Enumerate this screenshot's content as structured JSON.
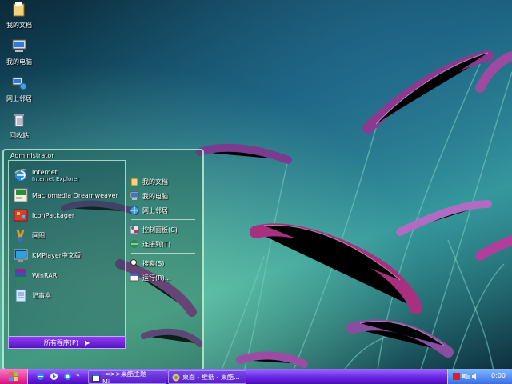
{
  "desktop": {
    "icons": [
      {
        "label": "我的文档",
        "icon": "folder-icon"
      },
      {
        "label": "我的电脑",
        "icon": "computer-icon"
      },
      {
        "label": "网上邻居",
        "icon": "network-icon"
      },
      {
        "label": "回收站",
        "icon": "recycle-bin-icon"
      }
    ]
  },
  "start_menu": {
    "user": "Administrator",
    "pinned": [
      {
        "title": "Internet",
        "subtitle": "Internet Explorer",
        "icon": "ie-icon"
      },
      {
        "title": "Macromedia Dreamweaver",
        "icon": "dreamweaver-icon"
      },
      {
        "title": "IconPackager",
        "icon": "iconpackager-icon"
      },
      {
        "title": "画图",
        "icon": "paint-icon"
      },
      {
        "title": "KMPlayer中文版",
        "icon": "kmplayer-icon"
      },
      {
        "title": "WinRAR",
        "icon": "winrar-icon"
      },
      {
        "title": "记事本",
        "icon": "notepad-icon"
      }
    ],
    "all_programs": "所有程序(P)",
    "all_programs_arrow": "▶",
    "right": [
      {
        "label": "我的文档",
        "icon": "folder-icon"
      },
      {
        "label": "我的电脑",
        "icon": "computer-icon"
      },
      {
        "label": "网上邻居",
        "icon": "network-icon"
      },
      {
        "label": "控制面板(C)",
        "icon": "control-panel-icon"
      },
      {
        "label": "连接到(T)",
        "icon": "connect-icon"
      },
      {
        "label": "搜索(S)",
        "icon": "search-icon"
      },
      {
        "label": "运行(R)...",
        "icon": "run-icon"
      }
    ]
  },
  "taskbar": {
    "tasks": [
      {
        "label": "-=>>桌酷主题 - Mi...",
        "icon": "window-icon"
      },
      {
        "label": "桌面 - 壁纸 - 桌酷...",
        "icon": "browser-icon"
      }
    ],
    "clock": "0:00"
  }
}
